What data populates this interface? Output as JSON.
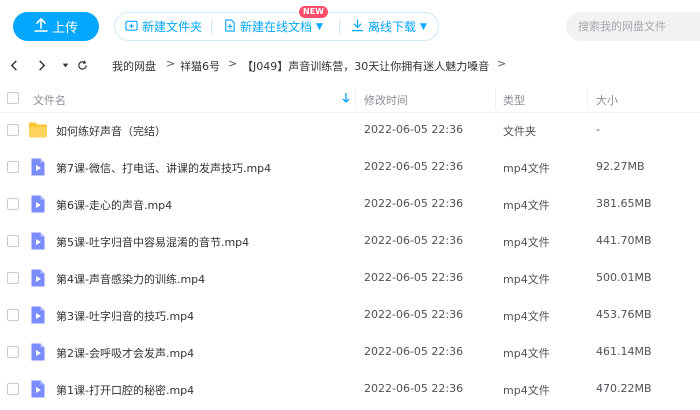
{
  "toolbar": {
    "upload_label": "上传",
    "new_folder_label": "新建文件夹",
    "new_online_doc_label": "新建在线文档",
    "new_badge": "NEW",
    "offline_download_label": "离线下载",
    "search_placeholder": "搜索我的网盘文件",
    "accent_color": "#06a7ff"
  },
  "breadcrumb": {
    "items": [
      "我的网盘",
      "祥猫6号",
      "【J049】声音训练营，30天让你拥有迷人魅力嗓音"
    ],
    "separator": ">"
  },
  "table": {
    "columns": [
      "文件名",
      "修改时间",
      "类型",
      "大小"
    ],
    "rows": [
      {
        "name": "如何练好声音（完结）",
        "time": "2022-06-05 22:36",
        "type": "文件夹",
        "size": "-",
        "icon": "folder-icon"
      },
      {
        "name": "第7课-微信、打电话、讲课的发声技巧.mp4",
        "time": "2022-06-05 22:36",
        "type": "mp4文件",
        "size": "92.27MB",
        "icon": "video-file-icon"
      },
      {
        "name": "第6课-走心的声音.mp4",
        "time": "2022-06-05 22:36",
        "type": "mp4文件",
        "size": "381.65MB",
        "icon": "video-file-icon"
      },
      {
        "name": "第5课-吐字归音中容易混淆的音节.mp4",
        "time": "2022-06-05 22:36",
        "type": "mp4文件",
        "size": "441.70MB",
        "icon": "video-file-icon"
      },
      {
        "name": "第4课-声音感染力的训练.mp4",
        "time": "2022-06-05 22:36",
        "type": "mp4文件",
        "size": "500.01MB",
        "icon": "video-file-icon"
      },
      {
        "name": "第3课-吐字归音的技巧.mp4",
        "time": "2022-06-05 22:36",
        "type": "mp4文件",
        "size": "453.76MB",
        "icon": "video-file-icon"
      },
      {
        "name": "第2课-会呼吸才会发声.mp4",
        "time": "2022-06-05 22:36",
        "type": "mp4文件",
        "size": "461.14MB",
        "icon": "video-file-icon"
      },
      {
        "name": "第1课-打开口腔的秘密.mp4",
        "time": "2022-06-05 22:36",
        "type": "mp4文件",
        "size": "470.22MB",
        "icon": "video-file-icon"
      }
    ]
  }
}
